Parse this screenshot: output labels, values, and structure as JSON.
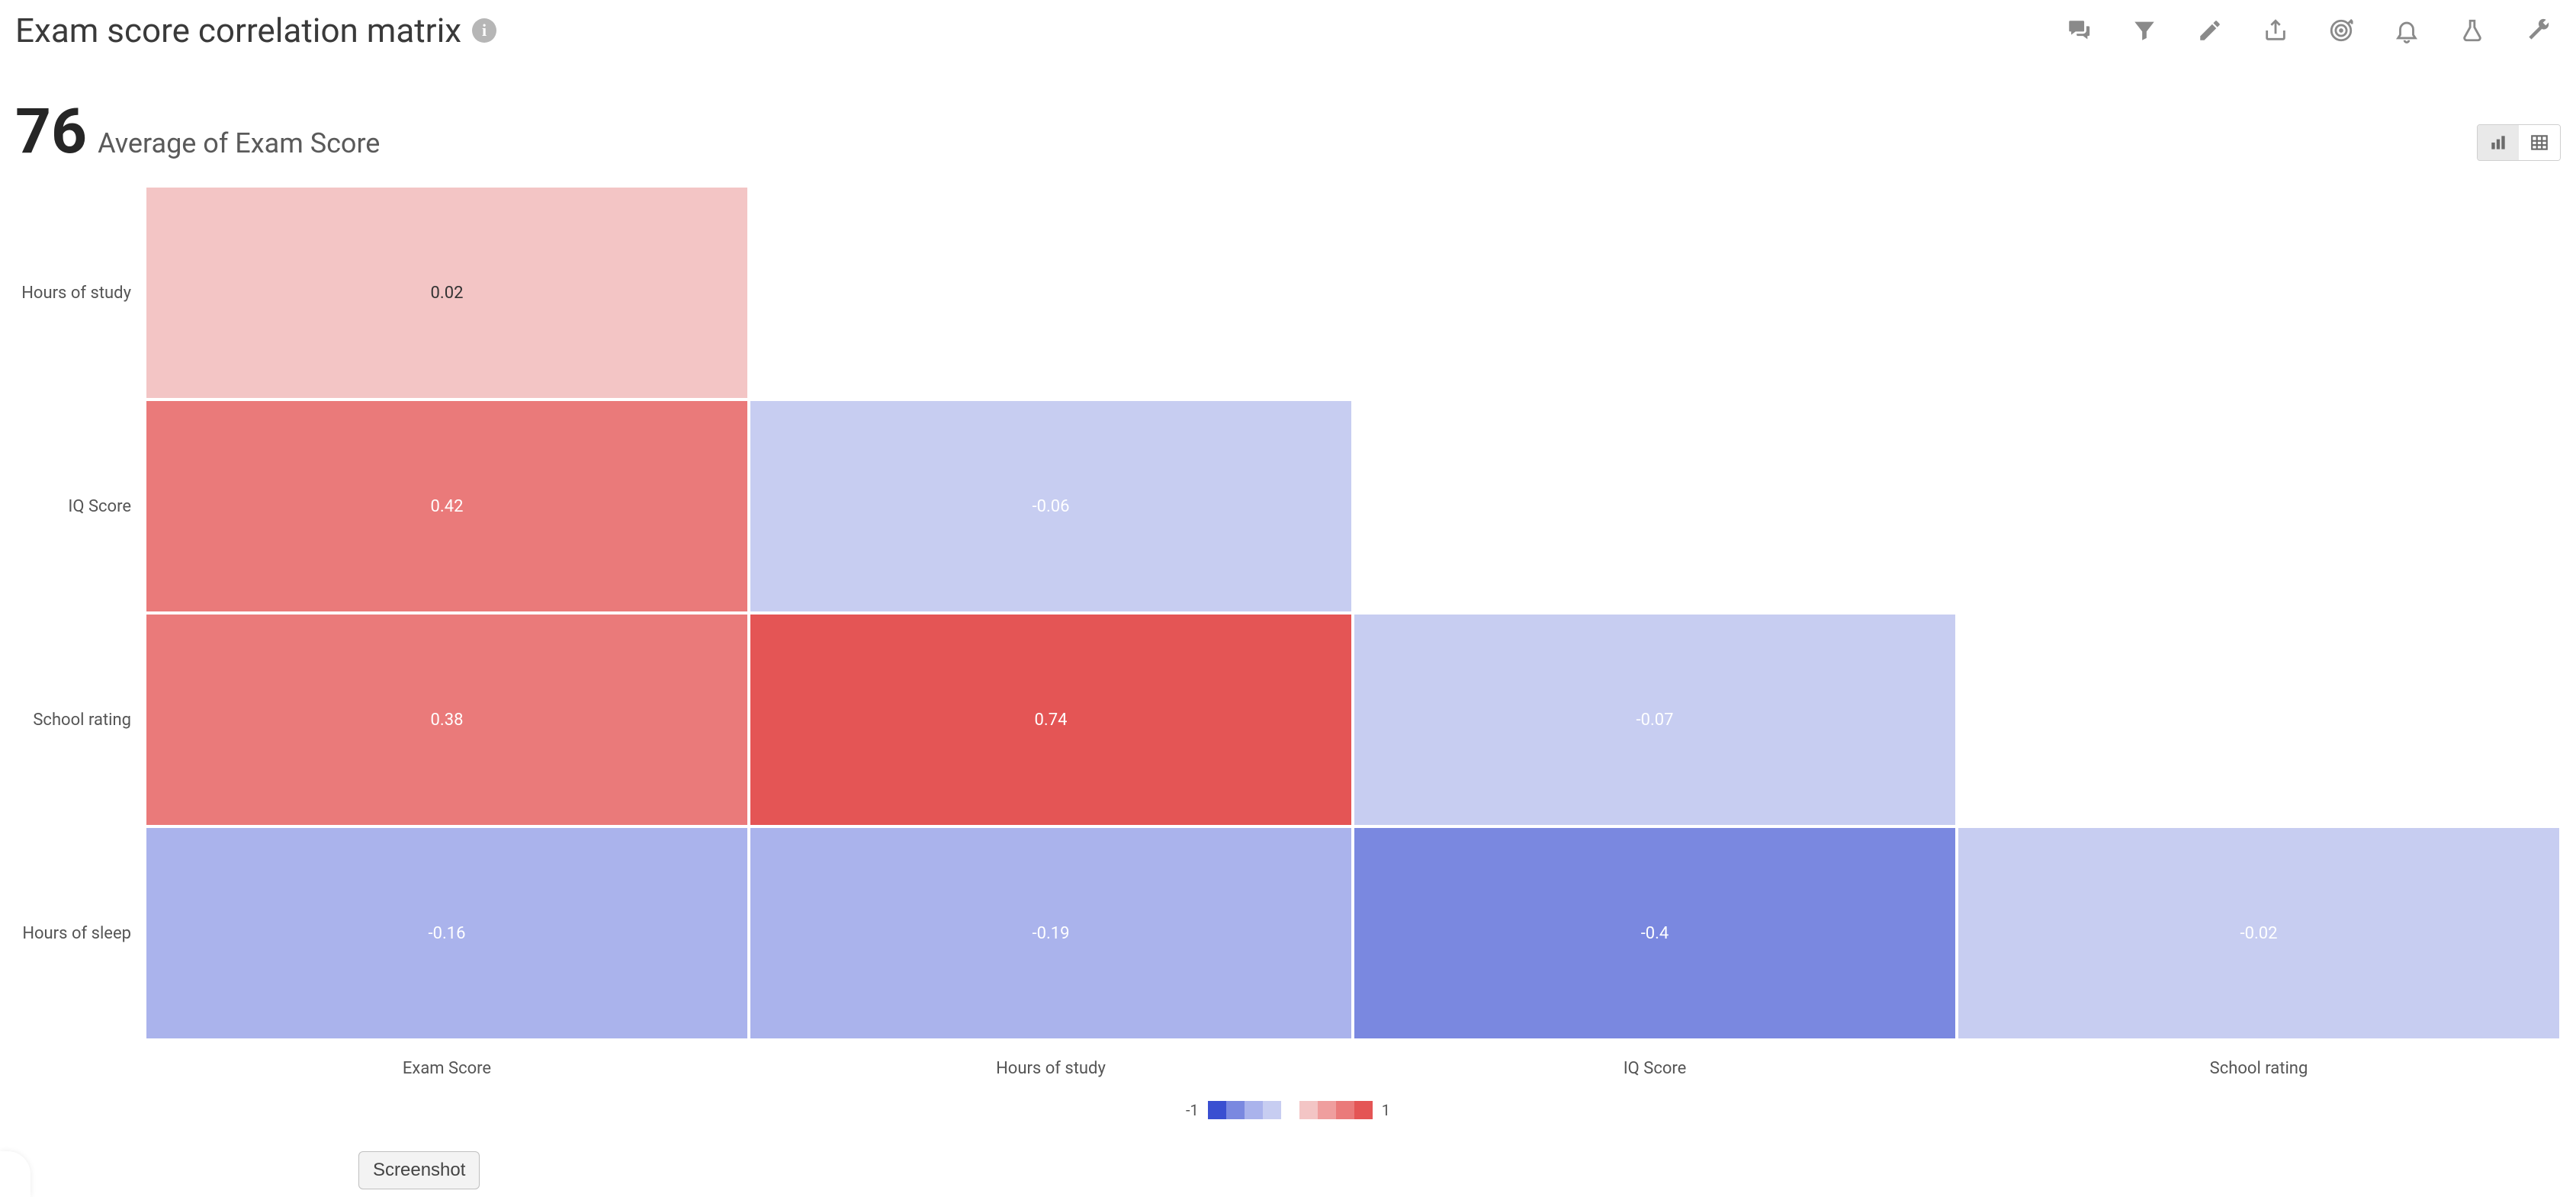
{
  "header": {
    "title": "Exam score correlation matrix",
    "info_tooltip": "i"
  },
  "toolbar": {
    "icons": [
      "chat-icon",
      "filter-icon",
      "pencil-icon",
      "share-icon",
      "target-icon",
      "bell-icon",
      "flask-icon",
      "wrench-icon"
    ]
  },
  "kpi": {
    "value": "76",
    "label": "Average of Exam Score"
  },
  "view_toggle": {
    "chart_active": true
  },
  "chart_data": {
    "type": "heatmap",
    "title": "Exam score correlation matrix",
    "xlabel": "",
    "ylabel": "",
    "x_categories": [
      "Exam Score",
      "Hours of study",
      "IQ Score",
      "School rating"
    ],
    "y_categories": [
      "Hours of study",
      "IQ Score",
      "School rating",
      "Hours of sleep"
    ],
    "matrix": [
      [
        0.02,
        null,
        null,
        null
      ],
      [
        0.42,
        -0.06,
        null,
        null
      ],
      [
        0.38,
        0.74,
        -0.07,
        null
      ],
      [
        -0.16,
        -0.19,
        -0.4,
        -0.02
      ]
    ],
    "color_scale": {
      "min": -1,
      "max": 1
    },
    "legend": {
      "min_label": "-1",
      "max_label": "1"
    }
  },
  "colors": {
    "neg3": "#3a4fd1",
    "neg2": "#7a88e0",
    "neg1": "#aab3ec",
    "neg0": "#c7cdf1",
    "pos0": "#f3c5c5",
    "pos1": "#ef9e9e",
    "pos2": "#ea7a7a",
    "pos3": "#e45555"
  },
  "buttons": {
    "screenshot": "Screenshot"
  }
}
